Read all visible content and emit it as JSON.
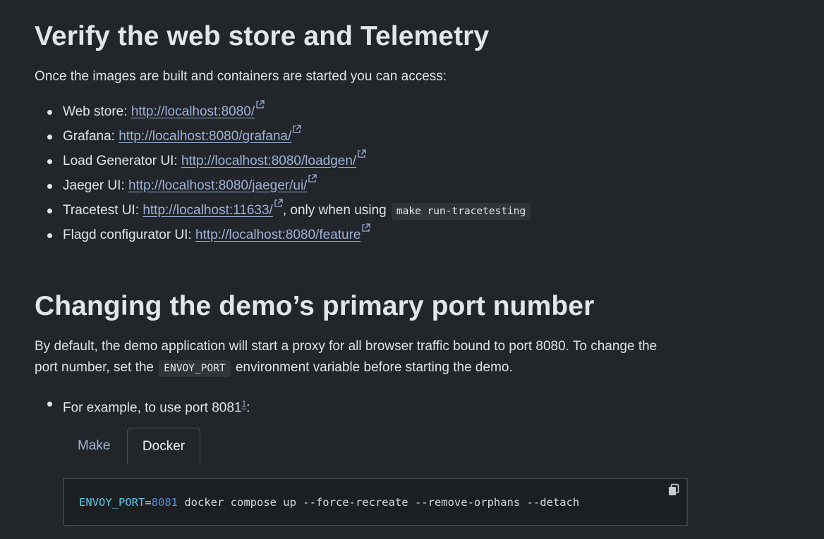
{
  "section1": {
    "heading": "Verify the web store and Telemetry",
    "intro": "Once the images are built and containers are started you can access:",
    "items": [
      {
        "label": "Web store: ",
        "url": "http://localhost:8080/"
      },
      {
        "label": "Grafana: ",
        "url": "http://localhost:8080/grafana/"
      },
      {
        "label": "Load Generator UI: ",
        "url": "http://localhost:8080/loadgen/"
      },
      {
        "label": "Jaeger UI: ",
        "url": "http://localhost:8080/jaeger/ui/"
      },
      {
        "label": "Tracetest UI: ",
        "url": "http://localhost:11633/",
        "suffix": ", only when using ",
        "code": "make run-tracetesting"
      },
      {
        "label": "Flagd configurator UI: ",
        "url": "http://localhost:8080/feature"
      }
    ]
  },
  "section2": {
    "heading": "Changing the demo’s primary port number",
    "para_before": "By default, the demo application will start a proxy for all browser traffic bound to port 8080. To change the port number, set the ",
    "para_code": "ENVOY_PORT",
    "para_after": " environment variable before starting the demo.",
    "example_text": "For example, to use port 8081",
    "footnote": "1",
    "example_colon": ":"
  },
  "tabs": [
    {
      "label": "Make",
      "active": false
    },
    {
      "label": "Docker",
      "active": true
    }
  ],
  "code": {
    "var": "ENVOY_PORT",
    "eq": "=",
    "num": "8081",
    "rest": " docker compose up --force-recreate --remove-orphans --detach"
  },
  "icons": {
    "external": "external-link-icon",
    "copy": "copy-icon"
  },
  "colors": {
    "background": "#222529",
    "link": "#9eb2d8",
    "code_var": "#5ec8e0",
    "code_num": "#5b8dd6"
  }
}
